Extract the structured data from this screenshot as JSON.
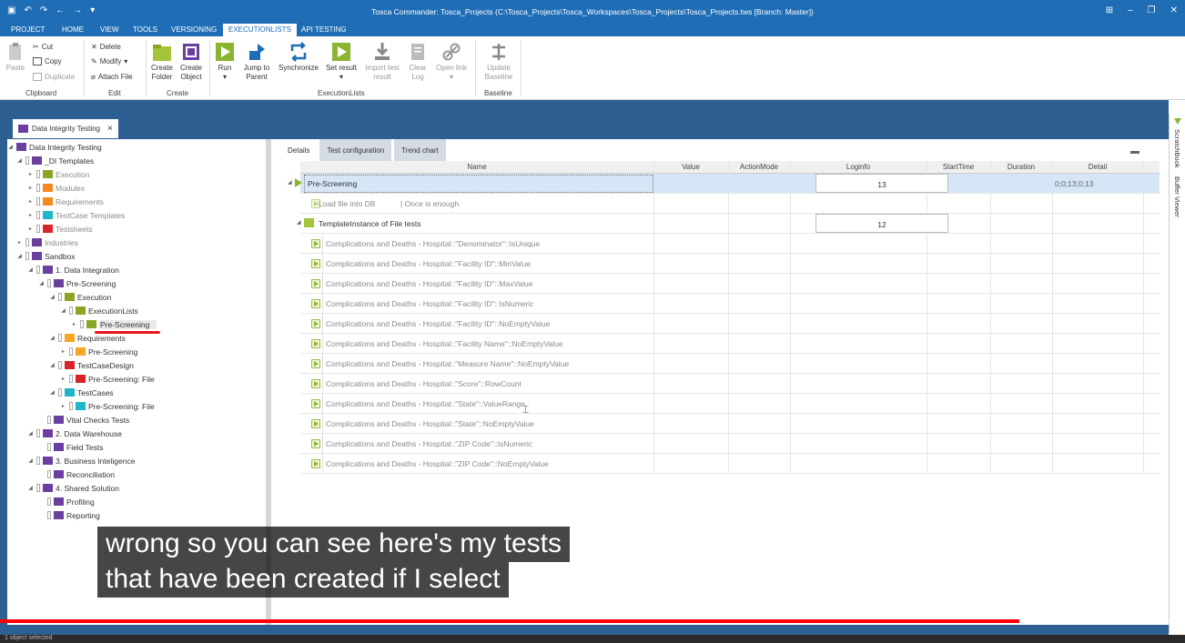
{
  "window": {
    "title": "Tosca Commander: Tosca_Projects (C:\\Tosca_Projects\\Tosca_Workspaces\\Tosca_Projects\\Tosca_Projects.tws [Branch: Master])"
  },
  "menu": [
    "PROJECT",
    "HOME",
    "VIEW",
    "TOOLS",
    "VERSIONING",
    "EXECUTIONLISTS",
    "API TESTING"
  ],
  "ribbon": {
    "paste": "Paste",
    "cut": "Cut",
    "copy": "Copy",
    "duplicate": "Duplicate",
    "clipboard": "Clipboard",
    "delete": "Delete",
    "modify": "Modify",
    "attach_file": "Attach File",
    "edit": "Edit",
    "create_folder": [
      "Create",
      "Folder"
    ],
    "create_object": [
      "Create",
      "Object"
    ],
    "create": "Create",
    "run": "Run",
    "jump_to_parent": [
      "Jump to",
      "Parent"
    ],
    "synchronize": "Synchronize",
    "set_result": "Set result",
    "import_test_result": [
      "Import test",
      "result"
    ],
    "clear_log": [
      "Clear",
      "Log"
    ],
    "open_link": "Open link",
    "executionlists": "ExecutionLists",
    "update_baseline": [
      "Update",
      "Baseline"
    ],
    "baseline": "Baseline"
  },
  "doc_tab": {
    "label": "Data Integrity Testing",
    "close": "×"
  },
  "tree": [
    {
      "label": "Data Integrity Testing",
      "color": "#6b3fa0"
    },
    {
      "label": "_DI Templates",
      "color": "#6b3fa0"
    },
    {
      "label": "Execution",
      "color": "#8aa622"
    },
    {
      "label": "Modules",
      "color": "#f5891f"
    },
    {
      "label": "Requirements",
      "color": "#f5891f"
    },
    {
      "label": "TestCase Templates",
      "color": "#1fb6c9"
    },
    {
      "label": "Testsheets",
      "color": "#d9252a"
    },
    {
      "label": "Industries",
      "color": "#6b3fa0"
    },
    {
      "label": "Sandbox",
      "color": "#6b3fa0"
    },
    {
      "label": "1. Data Integration",
      "color": "#6b3fa0"
    },
    {
      "label": "Pre-Screening",
      "color": "#6b3fa0"
    },
    {
      "label": "Execution",
      "color": "#8aa622"
    },
    {
      "label": "ExecutionLists",
      "color": "#8aa622"
    },
    {
      "label": "Pre-Screening",
      "color": "#8aa622"
    },
    {
      "label": "Requirements",
      "color": "#f5a623"
    },
    {
      "label": "Pre-Screening",
      "color": "#f5a623"
    },
    {
      "label": "TestCaseDesign",
      "color": "#d9252a"
    },
    {
      "label": "Pre-Screening: File",
      "color": "#d9252a"
    },
    {
      "label": "TestCases",
      "color": "#1fb6c9"
    },
    {
      "label": "Pre-Screening: File",
      "color": "#1fb6c9"
    },
    {
      "label": "Vital Checks Tests",
      "color": "#6b3fa0"
    },
    {
      "label": "2. Data Warehouse",
      "color": "#6b3fa0"
    },
    {
      "label": "Field Tests",
      "color": "#6b3fa0"
    },
    {
      "label": "3. Business Inteligence",
      "color": "#6b3fa0"
    },
    {
      "label": "Reconciliation",
      "color": "#6b3fa0"
    },
    {
      "label": "4. Shared Solution",
      "color": "#6b3fa0"
    },
    {
      "label": "Profiling",
      "color": "#6b3fa0"
    },
    {
      "label": "Reporting",
      "color": "#6b3fa0"
    }
  ],
  "tabs": [
    "Details",
    "Test configuration",
    "Trend chart"
  ],
  "columns": [
    "Name",
    "Value",
    "ActionMode",
    "Loginfo",
    "StartTime",
    "Duration",
    "Detail"
  ],
  "rows": {
    "pre_screening": {
      "name": "Pre-Screening",
      "loginfo": "13",
      "detail": "0;0;13;0;13"
    },
    "load_file": {
      "name": "Load file into DB",
      "note": "| Once is enough"
    },
    "template": {
      "name": "TemplateInstance of File tests",
      "loginfo": "12"
    }
  },
  "tests": [
    "Complications and Deaths - Hospital::\"Denominator\"::IsUnique",
    "Complications and Deaths - Hospital::\"Facility ID\"::MinValue",
    "Complications and Deaths - Hospital::\"Facility ID\"::MaxValue",
    "Complications and Deaths - Hospital::\"Facility ID\"::IsNumeric",
    "Complications and Deaths - Hospital::\"Facility ID\"::NoEmptyValue",
    "Complications and Deaths - Hospital::\"Facility Name\"::NoEmptyValue",
    "Complications and Deaths - Hospital::\"Measure Name\"::NoEmptyValue",
    "Complications and Deaths - Hospital::\"Score\"::RowCount",
    "Complications and Deaths - Hospital::\"State\"::ValueRange",
    "Complications and Deaths - Hospital::\"State\"::NoEmptyValue",
    "Complications and Deaths - Hospital::\"ZIP Code\"::IsNumeric",
    "Complications and Deaths - Hospital::\"ZIP Code\"::NoEmptyValue"
  ],
  "side_panels": [
    "ScratchBook",
    "Buffer Viewer"
  ],
  "captions": [
    "wrong so you can see here's my tests",
    "that have been created if I select"
  ],
  "status": "1 object selected",
  "video_progress_percent": 86
}
